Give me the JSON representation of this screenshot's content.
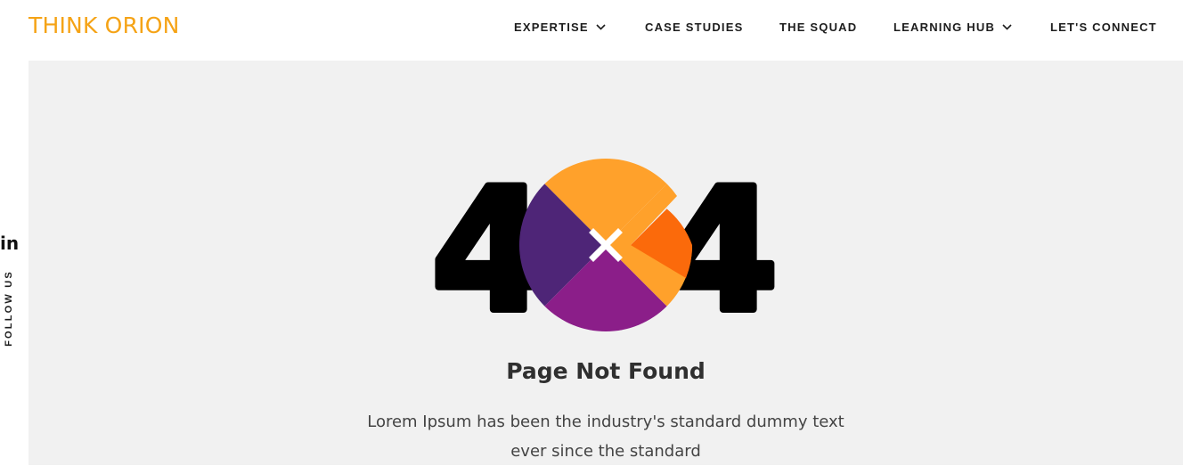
{
  "brand": {
    "logo_text": "THINK ORION",
    "accent_color": "#f5a316"
  },
  "nav": {
    "items": [
      {
        "label": "EXPERTISE",
        "has_dropdown": true
      },
      {
        "label": "CASE STUDIES",
        "has_dropdown": false
      },
      {
        "label": "THE SQUAD",
        "has_dropdown": false
      },
      {
        "label": "LEARNING HUB",
        "has_dropdown": true
      },
      {
        "label": "LET'S CONNECT",
        "has_dropdown": false
      }
    ]
  },
  "social": {
    "linkedin_icon": "linkedin-icon",
    "linkedin_glyph": "in",
    "follow_label": "FOLLOW US"
  },
  "error": {
    "code_left_digit": "4",
    "code_right_digit": "4",
    "circle_colors": {
      "top": "#ffa12b",
      "right": "#fb6a0b",
      "right_lower": "#ffa12b",
      "bottom": "#8b1e89",
      "left": "#4e2577"
    },
    "title": "Page Not Found",
    "description_line1": "Lorem Ipsum has been the industry's standard dummy text",
    "description_line2": "ever since the standard"
  },
  "colors": {
    "main_background": "#f1f1f1",
    "text_dark": "#1d1d1d"
  }
}
